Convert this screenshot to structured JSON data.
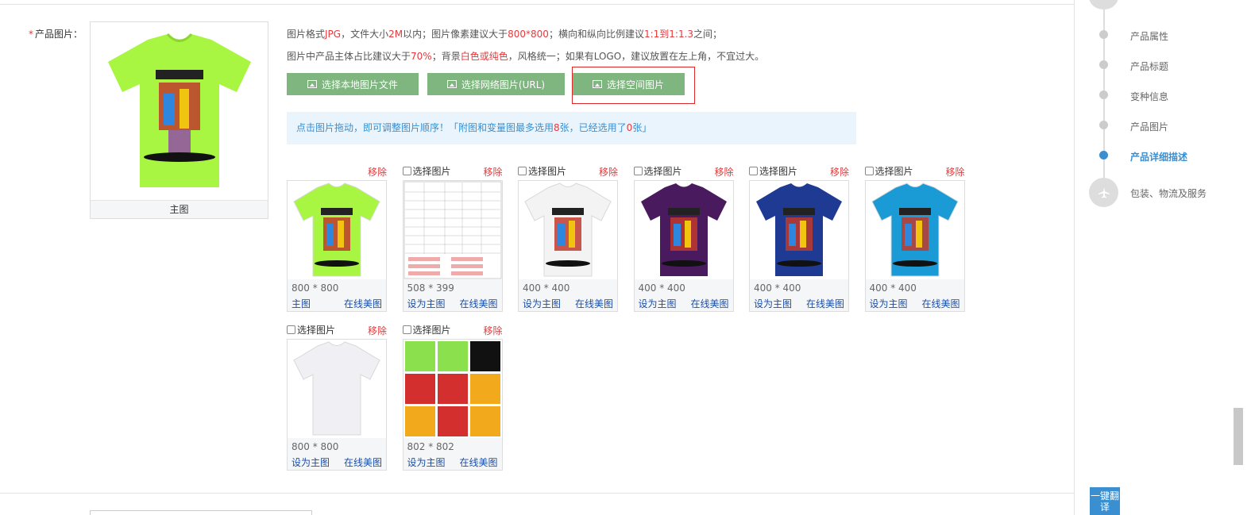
{
  "field": {
    "required_mark": "*",
    "label": "产品图片："
  },
  "main_image": {
    "caption": "主图"
  },
  "tips": {
    "line1": [
      {
        "text": "图片格式",
        "hl": false
      },
      {
        "text": "JPG",
        "hl": true
      },
      {
        "text": "，文件大小",
        "hl": false
      },
      {
        "text": "2M",
        "hl": true
      },
      {
        "text": "以内；图片像素建议大于",
        "hl": false
      },
      {
        "text": "800*800",
        "hl": true
      },
      {
        "text": "；横向和纵向比例建议",
        "hl": false
      },
      {
        "text": "1:1到1:1.3",
        "hl": true
      },
      {
        "text": "之间；",
        "hl": false
      }
    ],
    "line2": [
      {
        "text": "图片中产品主体占比建议大于",
        "hl": false
      },
      {
        "text": "70%",
        "hl": true
      },
      {
        "text": "；背景",
        "hl": false
      },
      {
        "text": "白色或纯色",
        "hl": true
      },
      {
        "text": "，风格统一；如果有LOGO，建议放置在左上角，不宜过大。",
        "hl": false
      }
    ]
  },
  "buttons": {
    "local": "选择本地图片文件",
    "network": "选择网络图片(URL)",
    "space": "选择空间图片"
  },
  "notice": [
    {
      "text": "点击图片拖动，即可调整图片顺序！「附图和变量图最多选用",
      "hl": false
    },
    {
      "text": "8",
      "hl": true
    },
    {
      "text": "张，已经选用了",
      "hl": false
    },
    {
      "text": "0",
      "hl": true
    },
    {
      "text": "张」",
      "hl": false
    }
  ],
  "select_label": "选择图片",
  "remove_label": "移除",
  "edit_label": "在线美图",
  "images": [
    {
      "size": "800 * 800",
      "action": "主图",
      "has_checkbox": false,
      "kind": "tshirt",
      "color": "#a8f542"
    },
    {
      "size": "508 * 399",
      "action": "设为主图",
      "has_checkbox": true,
      "kind": "sizechart",
      "color": "#ffffff"
    },
    {
      "size": "400 * 400",
      "action": "设为主图",
      "has_checkbox": true,
      "kind": "tshirt",
      "color": "#f3f3f3"
    },
    {
      "size": "400 * 400",
      "action": "设为主图",
      "has_checkbox": true,
      "kind": "tshirt",
      "color": "#4a1a5e"
    },
    {
      "size": "400 * 400",
      "action": "设为主图",
      "has_checkbox": true,
      "kind": "tshirt",
      "color": "#1f3a93"
    },
    {
      "size": "400 * 400",
      "action": "设为主图",
      "has_checkbox": true,
      "kind": "tshirt",
      "color": "#1a9bd6"
    },
    {
      "size": "800 * 800",
      "action": "设为主图",
      "has_checkbox": true,
      "kind": "tshirt-back",
      "color": "#f0f0f4"
    },
    {
      "size": "802 * 802",
      "action": "设为主图",
      "has_checkbox": true,
      "kind": "fabric",
      "color": "#ffffff"
    }
  ],
  "sidebar": {
    "items": [
      {
        "label": "产品属性",
        "active": false
      },
      {
        "label": "产品标题",
        "active": false
      },
      {
        "label": "变种信息",
        "active": false
      },
      {
        "label": "产品图片",
        "active": false
      },
      {
        "label": "产品详细描述",
        "active": true
      },
      {
        "label": "包装、物流及服务",
        "active": false
      }
    ],
    "translate_button": "一键翻译"
  }
}
